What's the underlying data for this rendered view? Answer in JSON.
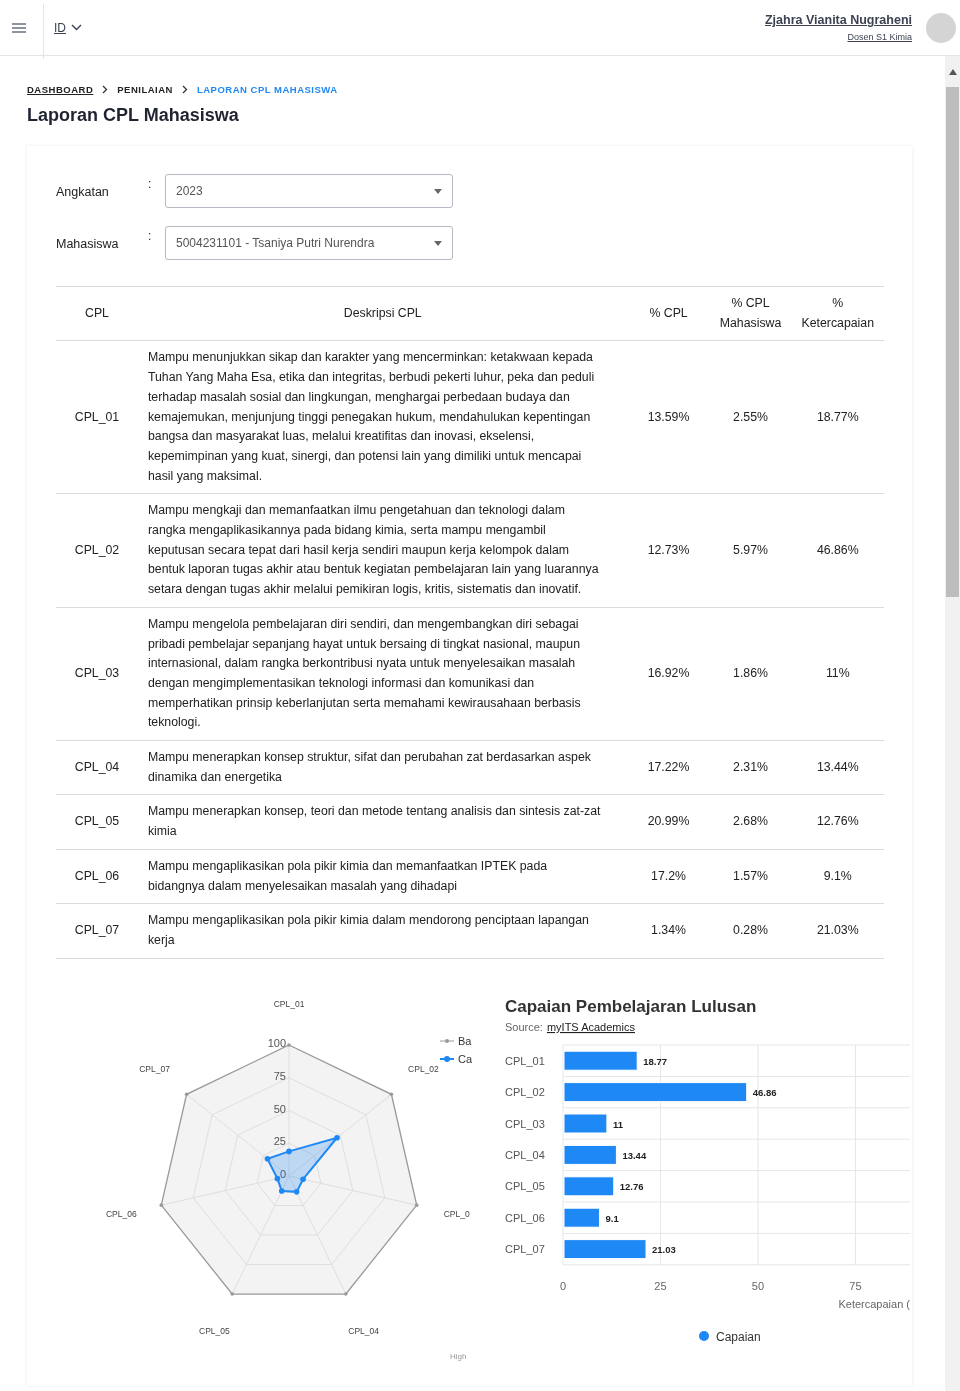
{
  "header": {
    "language": "ID",
    "user_name": "Zjahra Vianita Nugraheni",
    "user_role": "Dosen S1 Kimia"
  },
  "breadcrumb": [
    {
      "label": "DASHBOARD",
      "kind": "link"
    },
    {
      "label": "PENILAIAN",
      "kind": "plain"
    },
    {
      "label": "LAPORAN CPL MAHASISWA",
      "kind": "current"
    }
  ],
  "page_title": "Laporan CPL Mahasiswa",
  "filters": [
    {
      "label": "Angkatan",
      "separator": ":",
      "value": "2023"
    },
    {
      "label": "Mahasiswa",
      "separator": ":",
      "value": "5004231101 - Tsaniya Putri Nurendra"
    }
  ],
  "table": {
    "columns": [
      "CPL",
      "Deskripsi CPL",
      "% CPL",
      "% CPL Mahasiswa",
      "% Ketercapaian"
    ],
    "rows": [
      [
        "CPL_01",
        "Mampu menunjukkan sikap dan karakter yang mencerminkan: ketakwaan kepada Tuhan Yang Maha Esa, etika dan integritas, berbudi pekerti luhur, peka dan peduli terhadap masalah sosial dan lingkungan, menghargai perbedaan budaya dan kemajemukan, menjunjung tinggi penegakan hukum, mendahulukan kepentingan bangsa dan masyarakat luas, melalui kreatifitas dan inovasi, ekselensi, kepemimpinan yang kuat, sinergi, dan potensi lain yang dimiliki untuk mencapai hasil yang maksimal.",
        "13.59%",
        "2.55%",
        "18.77%"
      ],
      [
        "CPL_02",
        "Mampu mengkaji dan memanfaatkan ilmu pengetahuan dan teknologi dalam rangka mengaplikasikannya pada bidang kimia, serta mampu mengambil keputusan secara tepat dari hasil kerja sendiri maupun kerja kelompok dalam bentuk laporan tugas akhir atau bentuk kegiatan pembelajaran lain yang luarannya setara dengan tugas akhir melalui pemikiran logis, kritis, sistematis dan inovatif.",
        "12.73%",
        "5.97%",
        "46.86%"
      ],
      [
        "CPL_03",
        "Mampu mengelola pembelajaran diri sendiri, dan mengembangkan diri sebagai pribadi pembelajar sepanjang hayat untuk bersaing di tingkat nasional, maupun internasional, dalam rangka berkontribusi nyata untuk menyelesaikan masalah dengan mengimplementasikan teknologi informasi dan komunikasi dan memperhatikan prinsip keberlanjutan serta memahami kewirausahaan berbasis teknologi.",
        "16.92%",
        "1.86%",
        "11%"
      ],
      [
        "CPL_04",
        "Mampu menerapkan konsep struktur, sifat dan perubahan zat berdasarkan aspek dinamika dan energetika",
        "17.22%",
        "2.31%",
        "13.44%"
      ],
      [
        "CPL_05",
        "Mampu menerapkan konsep, teori dan metode tentang analisis dan sintesis zat-zat kimia",
        "20.99%",
        "2.68%",
        "12.76%"
      ],
      [
        "CPL_06",
        "Mampu mengaplikasikan pola pikir kimia dan memanfaatkan IPTEK pada bidangnya dalam menyelesaikan masalah yang dihadapi",
        "17.2%",
        "1.57%",
        "9.1%"
      ],
      [
        "CPL_07",
        "Mampu mengaplikasikan pola pikir kimia dalam mendorong penciptaan lapangan kerja",
        "1.34%",
        "0.28%",
        "21.03%"
      ]
    ]
  },
  "radar": {
    "axis_labels": [
      "CPL_01",
      "CPL_02",
      "CPL_0",
      "CPL_04",
      "CPL_05",
      "CPL_06",
      "CPL_07"
    ],
    "tick_labels": [
      "100",
      "75",
      "50",
      "25",
      "0"
    ],
    "legend": [
      {
        "name": "Ba",
        "color": "#999999"
      },
      {
        "name": "Ca",
        "color": "#1e88f5"
      }
    ],
    "credits": "High"
  },
  "bar_chart": {
    "subtitle_prefix": "Source:",
    "source_link": "myITS Academics",
    "chart_data": {
      "type": "bar",
      "orientation": "horizontal",
      "title": "Capaian Pembelajaran Lulusan",
      "xlabel": "Ketercapaian (",
      "categories": [
        "CPL_01",
        "CPL_02",
        "CPL_03",
        "CPL_04",
        "CPL_05",
        "CPL_06",
        "CPL_07"
      ],
      "xlim": [
        0,
        89
      ],
      "xticks": [
        0,
        25,
        50,
        75
      ],
      "grid": true,
      "data_labels": true,
      "series": [
        {
          "name": "Capaian",
          "color": "#1e88f5",
          "values": [
            18.77,
            46.86,
            11,
            13.44,
            12.76,
            9.1,
            21.03
          ]
        }
      ]
    }
  }
}
